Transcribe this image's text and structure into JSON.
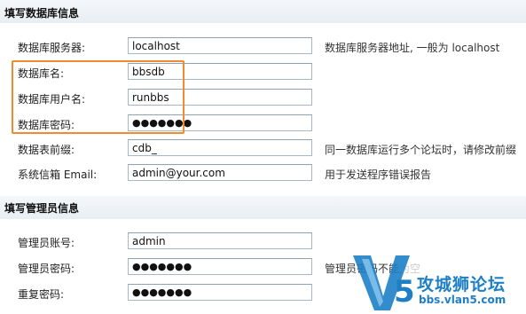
{
  "db_section": {
    "title": "填写数据库信息",
    "fields": [
      {
        "label": "数据库服务器:",
        "value": "localhost",
        "hint": "数据库服务器地址, 一般为 localhost"
      },
      {
        "label": "数据库名:",
        "value": "bbsdb",
        "hint": ""
      },
      {
        "label": "数据库用户名:",
        "value": "runbbs",
        "hint": ""
      },
      {
        "label": "数据库密码:",
        "value": "●●●●●●●",
        "hint": ""
      },
      {
        "label": "数据表前缀:",
        "value": "cdb_",
        "hint": "同一数据库运行多个论坛时，请修改前缀"
      },
      {
        "label": "系统信箱 Email:",
        "value": "admin@your.com",
        "hint": "用于发送程序错误报告"
      }
    ]
  },
  "admin_section": {
    "title": "填写管理员信息",
    "fields": [
      {
        "label": "管理员账号:",
        "value": "admin",
        "hint": ""
      },
      {
        "label": "管理员密码:",
        "value": "●●●●●●●",
        "hint": "管理员密码不能为空"
      },
      {
        "label": "重复密码:",
        "value": "●●●●●●●",
        "hint": ""
      }
    ]
  },
  "watermark": {
    "logo_glyph": "V5",
    "text_cn": "攻城狮论坛",
    "text_url": "bbs.vlan5.com"
  },
  "colors": {
    "highlight": "#f28a30",
    "watermark": "#1d7fc5",
    "input_border": "#a6b7c6"
  }
}
